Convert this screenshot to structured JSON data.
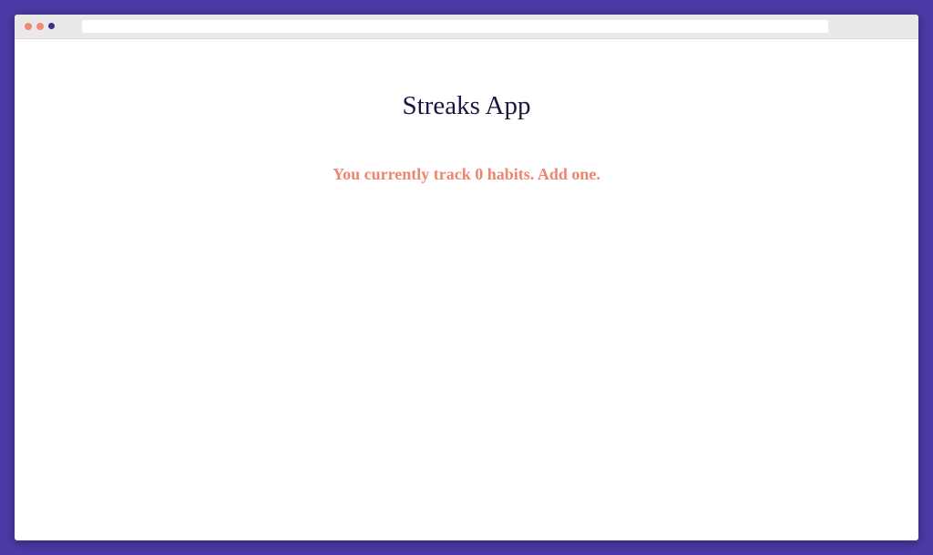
{
  "colors": {
    "background": "#4b3aa5",
    "window_bg": "#ffffff",
    "chrome_bg": "#ebe8e8",
    "title": "#191840",
    "message": "#ef8571",
    "dot_close": "#f08a78",
    "dot_minimize": "#f08a78",
    "dot_zoom": "#3b2f8f"
  },
  "browser": {
    "address": ""
  },
  "app": {
    "title": "Streaks App",
    "empty_message": "You currently track 0 habits. Add one."
  }
}
